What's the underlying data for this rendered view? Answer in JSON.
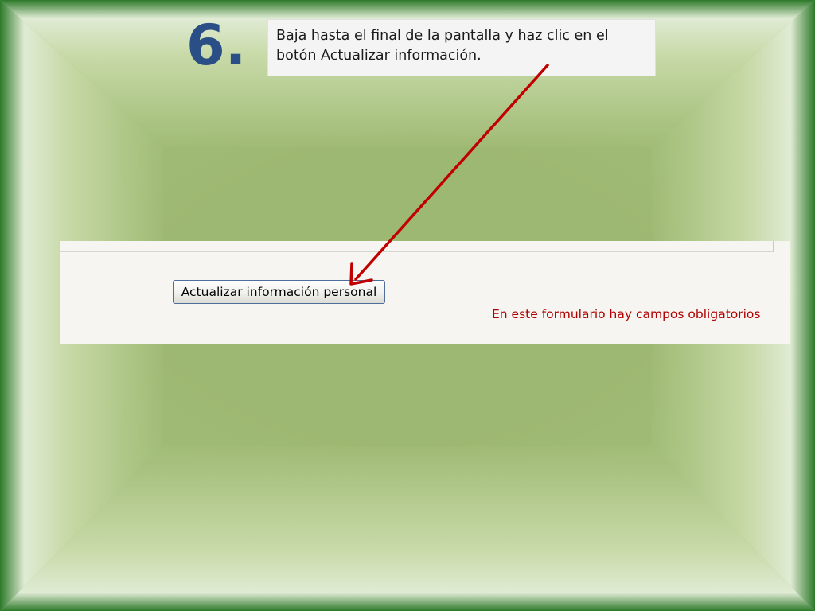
{
  "slide": {
    "step_number": "6.",
    "instruction": "Baja hasta el final de la pantalla y haz clic en el botón Actualizar información."
  },
  "form": {
    "update_button_label": "Actualizar información personal",
    "required_fields_note": "En este formulario hay campos obligatorios"
  },
  "colors": {
    "frame_green": "#2d7a2a",
    "step_number": "#2a4e86",
    "arrow": "#c00000",
    "required_note": "#b00000"
  }
}
